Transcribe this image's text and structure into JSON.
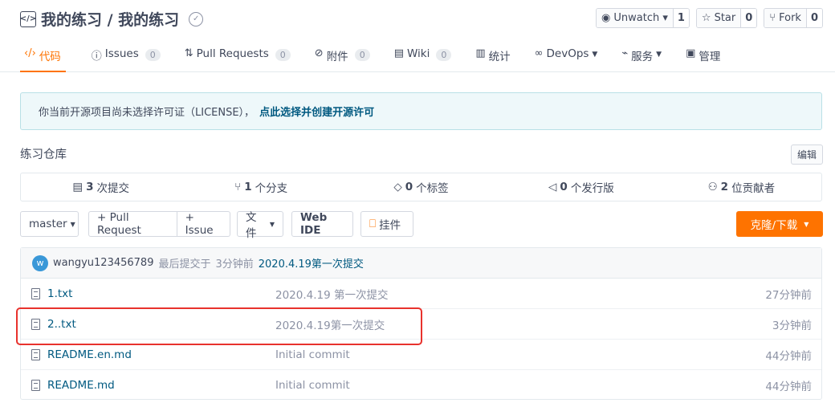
{
  "repo": {
    "title": "我的练习 / 我的练习"
  },
  "actions": [
    {
      "label": "Unwatch ▾",
      "count": "1",
      "icon": "eye-icon"
    },
    {
      "label": "Star",
      "count": "0",
      "icon": "star-icon"
    },
    {
      "label": "Fork",
      "count": "0",
      "icon": "fork-icon"
    }
  ],
  "tabs": [
    {
      "label": "代码",
      "icon": "code-icon",
      "active": true
    },
    {
      "label": "Issues",
      "count": "0",
      "icon": "issue-icon"
    },
    {
      "label": "Pull Requests",
      "count": "0",
      "icon": "pull-request-icon"
    },
    {
      "label": "附件",
      "count": "0",
      "icon": "attachment-icon"
    },
    {
      "label": "Wiki",
      "count": "0",
      "icon": "wiki-icon"
    },
    {
      "label": "统计",
      "icon": "stats-icon"
    },
    {
      "label": "DevOps",
      "icon": "devops-icon"
    },
    {
      "label": "服务",
      "icon": "service-icon"
    },
    {
      "label": "管理",
      "icon": "manage-icon"
    }
  ],
  "license": {
    "text": "你当前开源项目尚未选择许可证（LICENSE），",
    "link": "点此选择并创建开源许可"
  },
  "description": "练习仓库",
  "edit_label": "编辑",
  "stats": [
    {
      "value": "3",
      "label": "次提交",
      "icon": "commit-icon"
    },
    {
      "value": "1",
      "label": "个分支",
      "icon": "branch-icon"
    },
    {
      "value": "0",
      "label": "个标签",
      "icon": "tag-icon"
    },
    {
      "value": "0",
      "label": "个发行版",
      "icon": "release-icon"
    },
    {
      "value": "2",
      "label": "位贡献者",
      "icon": "contributors-icon"
    }
  ],
  "toolbar": {
    "branch": "master",
    "pull_request": "+ Pull Request",
    "issue": "+ Issue",
    "file": "文件",
    "web_ide": "Web IDE",
    "attach": "挂件",
    "clone": "克隆/下载"
  },
  "last_commit": {
    "avatar_letter": "w",
    "user": "wangyu123456789",
    "prefix": "最后提交于",
    "time": "3分钟前",
    "message": "2020.4.19第一次提交"
  },
  "files": [
    {
      "name": "1.txt",
      "message": "2020.4.19 第一次提交",
      "time": "27分钟前"
    },
    {
      "name": "2..txt",
      "message": "2020.4.19第一次提交",
      "time": "3分钟前"
    },
    {
      "name": "README.en.md",
      "message": "Initial commit",
      "time": "44分钟前"
    },
    {
      "name": "README.md",
      "message": "Initial commit",
      "time": "44分钟前"
    }
  ],
  "colors": {
    "accent": "#fe7300",
    "link": "#005980",
    "highlight": "#e8322d"
  }
}
